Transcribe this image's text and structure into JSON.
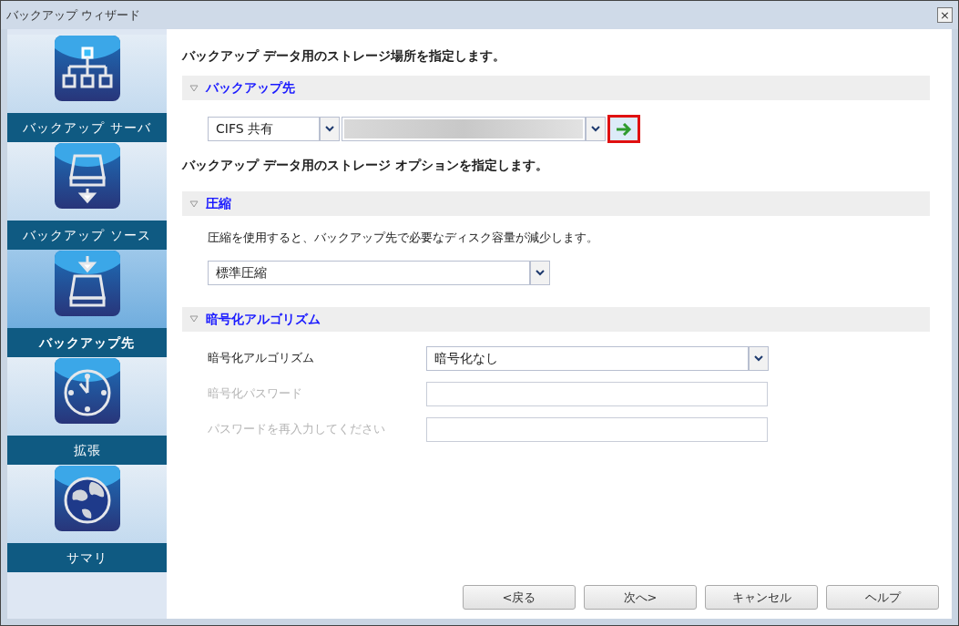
{
  "window": {
    "title": "バックアップ ウィザード",
    "close": "×"
  },
  "steps": [
    {
      "label": "バックアップ サーバ",
      "kind": "server",
      "selected": false
    },
    {
      "label": "バックアップ ソース",
      "kind": "source",
      "selected": false
    },
    {
      "label": "バックアップ先",
      "kind": "destination",
      "selected": true
    },
    {
      "label": "拡張",
      "kind": "schedule",
      "selected": false
    },
    {
      "label": "サマリ",
      "kind": "summary",
      "selected": false
    }
  ],
  "intro": "バックアップ データ用のストレージ場所を指定します。",
  "destination_section": {
    "title": "バックアップ先",
    "expanded": true,
    "type_value": "CIFS 共有",
    "go_highlighted": true
  },
  "options_intro": "バックアップ データ用のストレージ オプションを指定します。",
  "compression_section": {
    "title": "圧縮",
    "expanded": true,
    "description": "圧縮を使用すると、バックアップ先で必要なディスク容量が減少します。",
    "value": "標準圧縮"
  },
  "encryption_section": {
    "title": "暗号化アルゴリズム",
    "expanded": true,
    "rows": [
      {
        "label": "暗号化アルゴリズム",
        "kind": "select",
        "value": "暗号化なし",
        "disabled": false
      },
      {
        "label": "暗号化パスワード",
        "kind": "password",
        "disabled": true
      },
      {
        "label": "パスワードを再入力してください",
        "kind": "password",
        "disabled": true
      }
    ]
  },
  "buttons": [
    "<戻る",
    "次へ>",
    "キャンセル",
    "ヘルプ"
  ]
}
